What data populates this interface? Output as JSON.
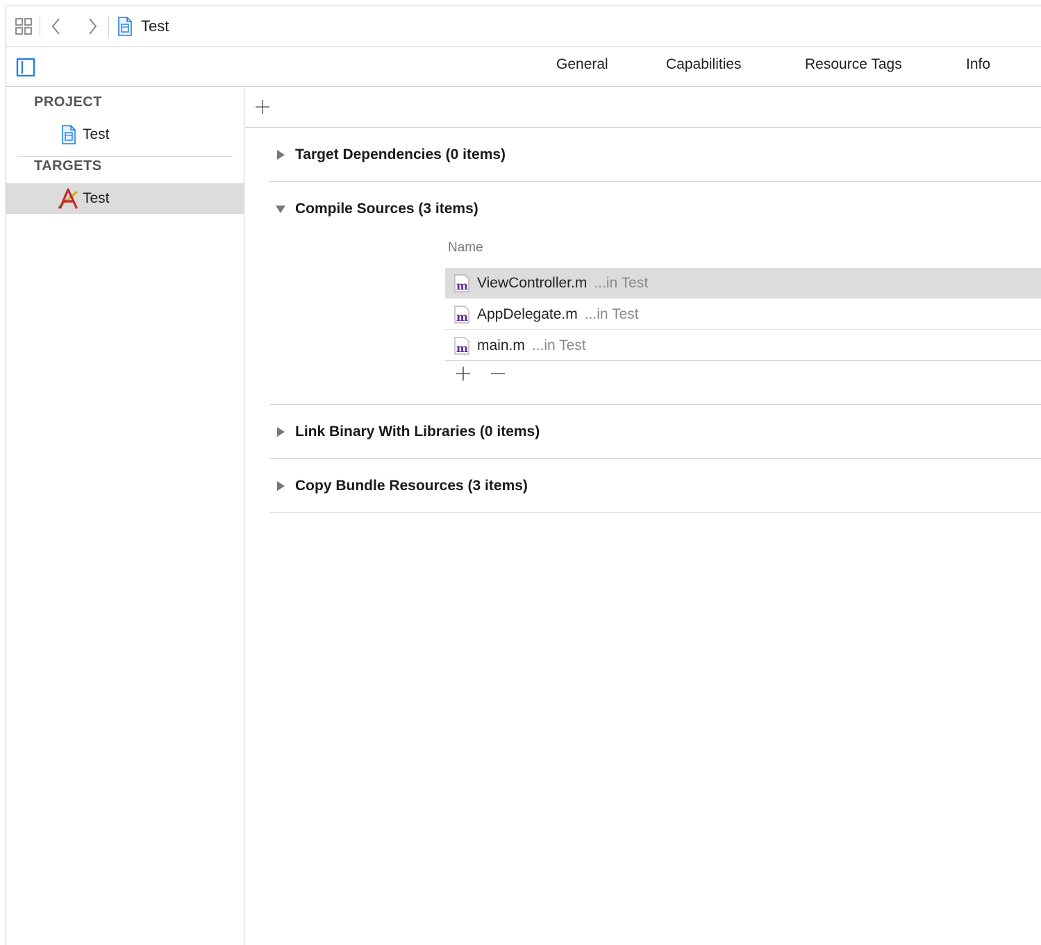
{
  "jumpbar": {
    "title": "Test",
    "icons": [
      "grid-icon",
      "back-icon",
      "forward-icon",
      "project-file-icon"
    ]
  },
  "tabs": [
    {
      "label": "General"
    },
    {
      "label": "Capabilities"
    },
    {
      "label": "Resource Tags"
    },
    {
      "label": "Info"
    }
  ],
  "sidebar": {
    "project_header": "PROJECT",
    "project_item": "Test",
    "targets_header": "TARGETS",
    "target_item": "Test"
  },
  "phases": {
    "target_dependencies": "Target Dependencies (0 items)",
    "compile_sources": "Compile Sources (3 items)",
    "link_binary": "Link Binary With Libraries (0 items)",
    "copy_bundle": "Copy Bundle Resources (3 items)"
  },
  "compile_sources": {
    "column_name": "Name",
    "files": [
      {
        "name": "ViewController.m",
        "location": "...in Test"
      },
      {
        "name": "AppDelegate.m",
        "location": "...in Test"
      },
      {
        "name": "main.m",
        "location": "...in Test"
      }
    ]
  },
  "colors": {
    "accent_blue": "#1f7fe6",
    "selection_gray": "#dcdcdc",
    "objc_purple": "#5a2d9c"
  }
}
